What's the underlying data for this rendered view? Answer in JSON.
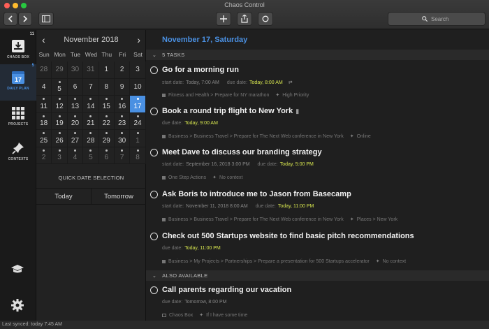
{
  "app": {
    "title": "Chaos Control"
  },
  "toolbar": {
    "search_placeholder": "Search"
  },
  "sidebar": {
    "items": [
      {
        "label": "CHAOS BOX",
        "count": "11"
      },
      {
        "label": "DAILY PLAN",
        "count": "5",
        "day": "17"
      },
      {
        "label": "PROJECTS"
      },
      {
        "label": "CONTEXTS"
      }
    ]
  },
  "calendar": {
    "month": "November 2018",
    "weekdays": [
      "Sun",
      "Mon",
      "Tue",
      "Wed",
      "Thu",
      "Fri",
      "Sat"
    ],
    "weeks": [
      [
        "28",
        "29",
        "30",
        "31",
        "1",
        "2",
        "3"
      ],
      [
        "4",
        "5",
        "6",
        "7",
        "8",
        "9",
        "10"
      ],
      [
        "11",
        "12",
        "13",
        "14",
        "15",
        "16",
        "17"
      ],
      [
        "18",
        "19",
        "20",
        "21",
        "22",
        "23",
        "24"
      ],
      [
        "25",
        "26",
        "27",
        "28",
        "29",
        "30",
        "1"
      ],
      [
        "2",
        "3",
        "4",
        "5",
        "6",
        "7",
        "8"
      ]
    ],
    "selected": "17",
    "quick_selection_label": "QUICK DATE SELECTION",
    "quick_buttons": [
      "Today",
      "Tomorrow"
    ]
  },
  "main": {
    "date_title": "November 17, Saturday",
    "tasks_header": "5 TASKS",
    "also_header": "ALSO AVAILABLE",
    "tasks": [
      {
        "title": "Go for a morning run",
        "start_label": "start date:",
        "start": "Today, 7:00 AM",
        "due_label": "due date:",
        "due": "Today, 8:00 AM",
        "path": "Fitness and Health > Prepare for NY marathon",
        "context": "High Priority"
      },
      {
        "title": "Book a round trip flight to New York",
        "due_label": "due date:",
        "due": "Today, 9:00 AM",
        "path": "Business > Business Travel > Prepare for The Next Web conference in New York",
        "context": "Online"
      },
      {
        "title": "Meet Dave to discuss our branding strategy",
        "start_label": "start date:",
        "start": "September 16, 2018 3:00 PM",
        "due_label": "due date:",
        "due": "Today, 5:00 PM",
        "path": "One Step Actions",
        "context": "No context"
      },
      {
        "title": "Ask Boris to introduce me to Jason from Basecamp",
        "start_label": "start date:",
        "start": "November 11, 2018 8:00 AM",
        "due_label": "due date:",
        "due": "Today, 11:00 PM",
        "path": "Business > Business Travel > Prepare for The Next Web conference in New York",
        "context": "Places > New York"
      },
      {
        "title": "Check out 500 Startups website to find basic pitch recommendations",
        "due_label": "due date:",
        "due": "Today, 11:00 PM",
        "path": "Business > My Projects > Partnerships > Prepare a presentation for 500 Startups accelerator",
        "context": "No context"
      }
    ],
    "also": [
      {
        "title": "Call parents regarding our vacation",
        "due_label": "due date:",
        "due": "Tomorrow, 8:00 PM",
        "path": "Chaos Box",
        "context": "If I have some time"
      }
    ]
  },
  "status": {
    "text": "Last synced: today 7:45 AM"
  },
  "colors": {
    "accent": "#4a90e2",
    "due": "#d7e64f"
  }
}
